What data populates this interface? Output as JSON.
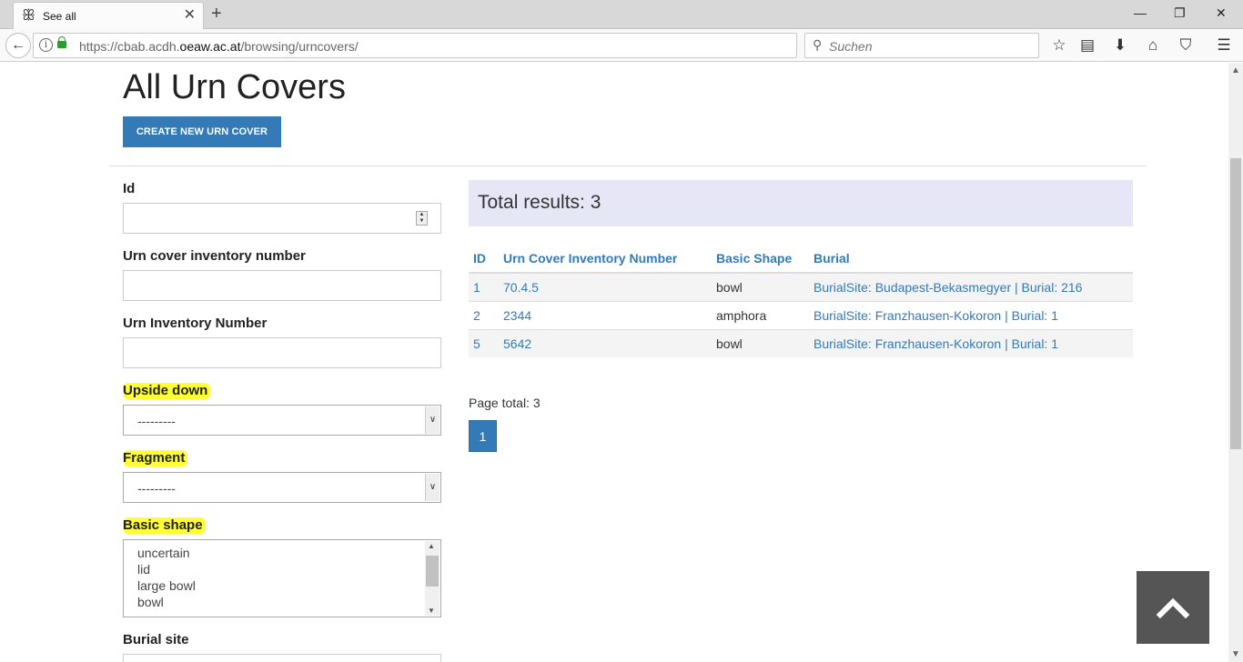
{
  "browser": {
    "tab_title": "See all",
    "url_prefix": "https://cbab.acdh.",
    "url_domain": "oeaw.ac.at",
    "url_path": "/browsing/urncovers/",
    "search_placeholder": "Suchen"
  },
  "page": {
    "title": "All Urn Covers",
    "create_button": "CREATE NEW URN COVER"
  },
  "filters": {
    "id_label": "Id",
    "urn_cover_inventory_label": "Urn cover inventory number",
    "urn_inventory_label": "Urn Inventory Number",
    "upside_down_label": "Upside down",
    "upside_down_value": "---------",
    "fragment_label": "Fragment",
    "fragment_value": "---------",
    "basic_shape_label": "Basic shape",
    "basic_shape_options": [
      "uncertain",
      "lid",
      "large bowl",
      "bowl"
    ],
    "burial_site_label": "Burial site"
  },
  "results": {
    "total_text": "Total results: 3",
    "headers": [
      "ID",
      "Urn Cover Inventory Number",
      "Basic Shape",
      "Burial"
    ],
    "rows": [
      {
        "id": "1",
        "inv": "70.4.5",
        "shape": "bowl",
        "burial": "BurialSite: Budapest-Bekasmegyer | Burial: 216"
      },
      {
        "id": "2",
        "inv": "2344",
        "shape": "amphora",
        "burial": "BurialSite: Franzhausen-Kokoron | Burial: 1"
      },
      {
        "id": "5",
        "inv": "5642",
        "shape": "bowl",
        "burial": "BurialSite: Franzhausen-Kokoron | Burial: 1"
      }
    ],
    "page_total": "Page total: 3",
    "current_page": "1"
  },
  "colors": {
    "primary": "#337ab7",
    "highlight": "#ffff33",
    "results_bg": "#e6e6f6"
  }
}
